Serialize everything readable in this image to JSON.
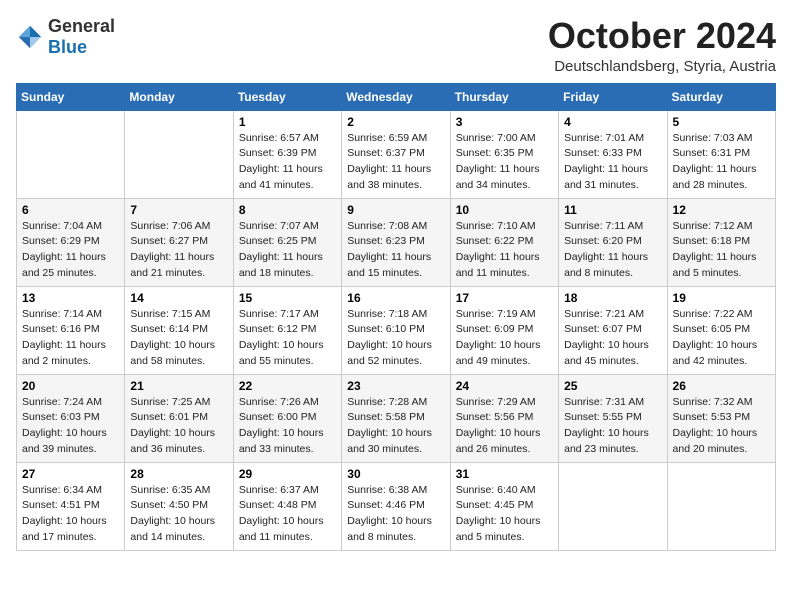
{
  "logo": {
    "general": "General",
    "blue": "Blue"
  },
  "title": "October 2024",
  "subtitle": "Deutschlandsberg, Styria, Austria",
  "days_of_week": [
    "Sunday",
    "Monday",
    "Tuesday",
    "Wednesday",
    "Thursday",
    "Friday",
    "Saturday"
  ],
  "weeks": [
    [
      {
        "day": "",
        "info": ""
      },
      {
        "day": "",
        "info": ""
      },
      {
        "day": "1",
        "info": "Sunrise: 6:57 AM\nSunset: 6:39 PM\nDaylight: 11 hours and 41 minutes."
      },
      {
        "day": "2",
        "info": "Sunrise: 6:59 AM\nSunset: 6:37 PM\nDaylight: 11 hours and 38 minutes."
      },
      {
        "day": "3",
        "info": "Sunrise: 7:00 AM\nSunset: 6:35 PM\nDaylight: 11 hours and 34 minutes."
      },
      {
        "day": "4",
        "info": "Sunrise: 7:01 AM\nSunset: 6:33 PM\nDaylight: 11 hours and 31 minutes."
      },
      {
        "day": "5",
        "info": "Sunrise: 7:03 AM\nSunset: 6:31 PM\nDaylight: 11 hours and 28 minutes."
      }
    ],
    [
      {
        "day": "6",
        "info": "Sunrise: 7:04 AM\nSunset: 6:29 PM\nDaylight: 11 hours and 25 minutes."
      },
      {
        "day": "7",
        "info": "Sunrise: 7:06 AM\nSunset: 6:27 PM\nDaylight: 11 hours and 21 minutes."
      },
      {
        "day": "8",
        "info": "Sunrise: 7:07 AM\nSunset: 6:25 PM\nDaylight: 11 hours and 18 minutes."
      },
      {
        "day": "9",
        "info": "Sunrise: 7:08 AM\nSunset: 6:23 PM\nDaylight: 11 hours and 15 minutes."
      },
      {
        "day": "10",
        "info": "Sunrise: 7:10 AM\nSunset: 6:22 PM\nDaylight: 11 hours and 11 minutes."
      },
      {
        "day": "11",
        "info": "Sunrise: 7:11 AM\nSunset: 6:20 PM\nDaylight: 11 hours and 8 minutes."
      },
      {
        "day": "12",
        "info": "Sunrise: 7:12 AM\nSunset: 6:18 PM\nDaylight: 11 hours and 5 minutes."
      }
    ],
    [
      {
        "day": "13",
        "info": "Sunrise: 7:14 AM\nSunset: 6:16 PM\nDaylight: 11 hours and 2 minutes."
      },
      {
        "day": "14",
        "info": "Sunrise: 7:15 AM\nSunset: 6:14 PM\nDaylight: 10 hours and 58 minutes."
      },
      {
        "day": "15",
        "info": "Sunrise: 7:17 AM\nSunset: 6:12 PM\nDaylight: 10 hours and 55 minutes."
      },
      {
        "day": "16",
        "info": "Sunrise: 7:18 AM\nSunset: 6:10 PM\nDaylight: 10 hours and 52 minutes."
      },
      {
        "day": "17",
        "info": "Sunrise: 7:19 AM\nSunset: 6:09 PM\nDaylight: 10 hours and 49 minutes."
      },
      {
        "day": "18",
        "info": "Sunrise: 7:21 AM\nSunset: 6:07 PM\nDaylight: 10 hours and 45 minutes."
      },
      {
        "day": "19",
        "info": "Sunrise: 7:22 AM\nSunset: 6:05 PM\nDaylight: 10 hours and 42 minutes."
      }
    ],
    [
      {
        "day": "20",
        "info": "Sunrise: 7:24 AM\nSunset: 6:03 PM\nDaylight: 10 hours and 39 minutes."
      },
      {
        "day": "21",
        "info": "Sunrise: 7:25 AM\nSunset: 6:01 PM\nDaylight: 10 hours and 36 minutes."
      },
      {
        "day": "22",
        "info": "Sunrise: 7:26 AM\nSunset: 6:00 PM\nDaylight: 10 hours and 33 minutes."
      },
      {
        "day": "23",
        "info": "Sunrise: 7:28 AM\nSunset: 5:58 PM\nDaylight: 10 hours and 30 minutes."
      },
      {
        "day": "24",
        "info": "Sunrise: 7:29 AM\nSunset: 5:56 PM\nDaylight: 10 hours and 26 minutes."
      },
      {
        "day": "25",
        "info": "Sunrise: 7:31 AM\nSunset: 5:55 PM\nDaylight: 10 hours and 23 minutes."
      },
      {
        "day": "26",
        "info": "Sunrise: 7:32 AM\nSunset: 5:53 PM\nDaylight: 10 hours and 20 minutes."
      }
    ],
    [
      {
        "day": "27",
        "info": "Sunrise: 6:34 AM\nSunset: 4:51 PM\nDaylight: 10 hours and 17 minutes."
      },
      {
        "day": "28",
        "info": "Sunrise: 6:35 AM\nSunset: 4:50 PM\nDaylight: 10 hours and 14 minutes."
      },
      {
        "day": "29",
        "info": "Sunrise: 6:37 AM\nSunset: 4:48 PM\nDaylight: 10 hours and 11 minutes."
      },
      {
        "day": "30",
        "info": "Sunrise: 6:38 AM\nSunset: 4:46 PM\nDaylight: 10 hours and 8 minutes."
      },
      {
        "day": "31",
        "info": "Sunrise: 6:40 AM\nSunset: 4:45 PM\nDaylight: 10 hours and 5 minutes."
      },
      {
        "day": "",
        "info": ""
      },
      {
        "day": "",
        "info": ""
      }
    ]
  ]
}
